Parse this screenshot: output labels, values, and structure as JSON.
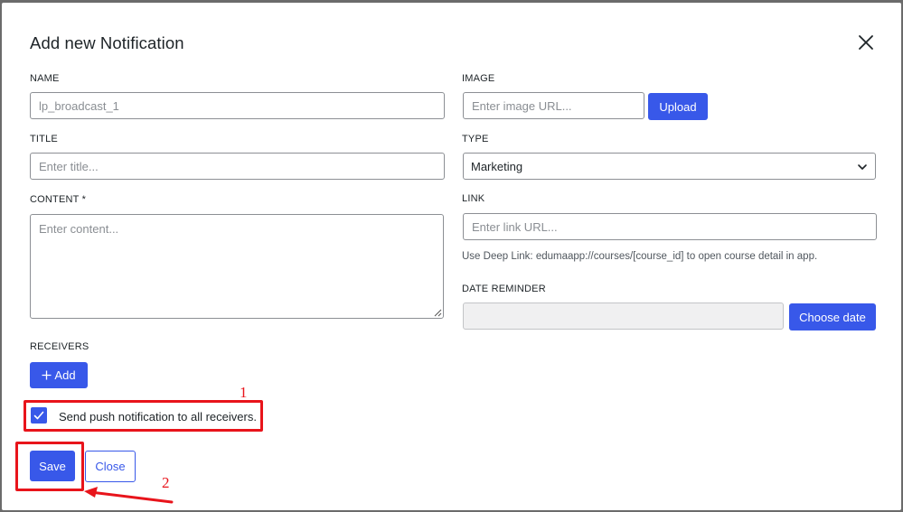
{
  "modal": {
    "title": "Add new Notification"
  },
  "fields": {
    "name": {
      "label": "NAME",
      "value": "lp_broadcast_1"
    },
    "image": {
      "label": "IMAGE",
      "placeholder": "Enter image URL...",
      "upload_label": "Upload"
    },
    "title": {
      "label": "TITLE",
      "placeholder": "Enter title..."
    },
    "type": {
      "label": "TYPE",
      "selected": "Marketing"
    },
    "content": {
      "label": "CONTENT *",
      "placeholder": "Enter content..."
    },
    "link": {
      "label": "LINK",
      "placeholder": "Enter link URL...",
      "help": "Use Deep Link: edumaapp://courses/[course_id] to open course detail in app."
    },
    "date_reminder": {
      "label": "DATE REMINDER",
      "choose_label": "Choose date"
    },
    "receivers": {
      "label": "RECEIVERS",
      "add_label": "Add"
    }
  },
  "push_all": {
    "label": "Send push notification to all receivers.",
    "checked": true
  },
  "footer": {
    "save_label": "Save",
    "close_label": "Close"
  },
  "annotations": {
    "step1": "1",
    "step2": "2"
  },
  "colors": {
    "accent": "#3858e9",
    "annotation": "#e8141b"
  }
}
